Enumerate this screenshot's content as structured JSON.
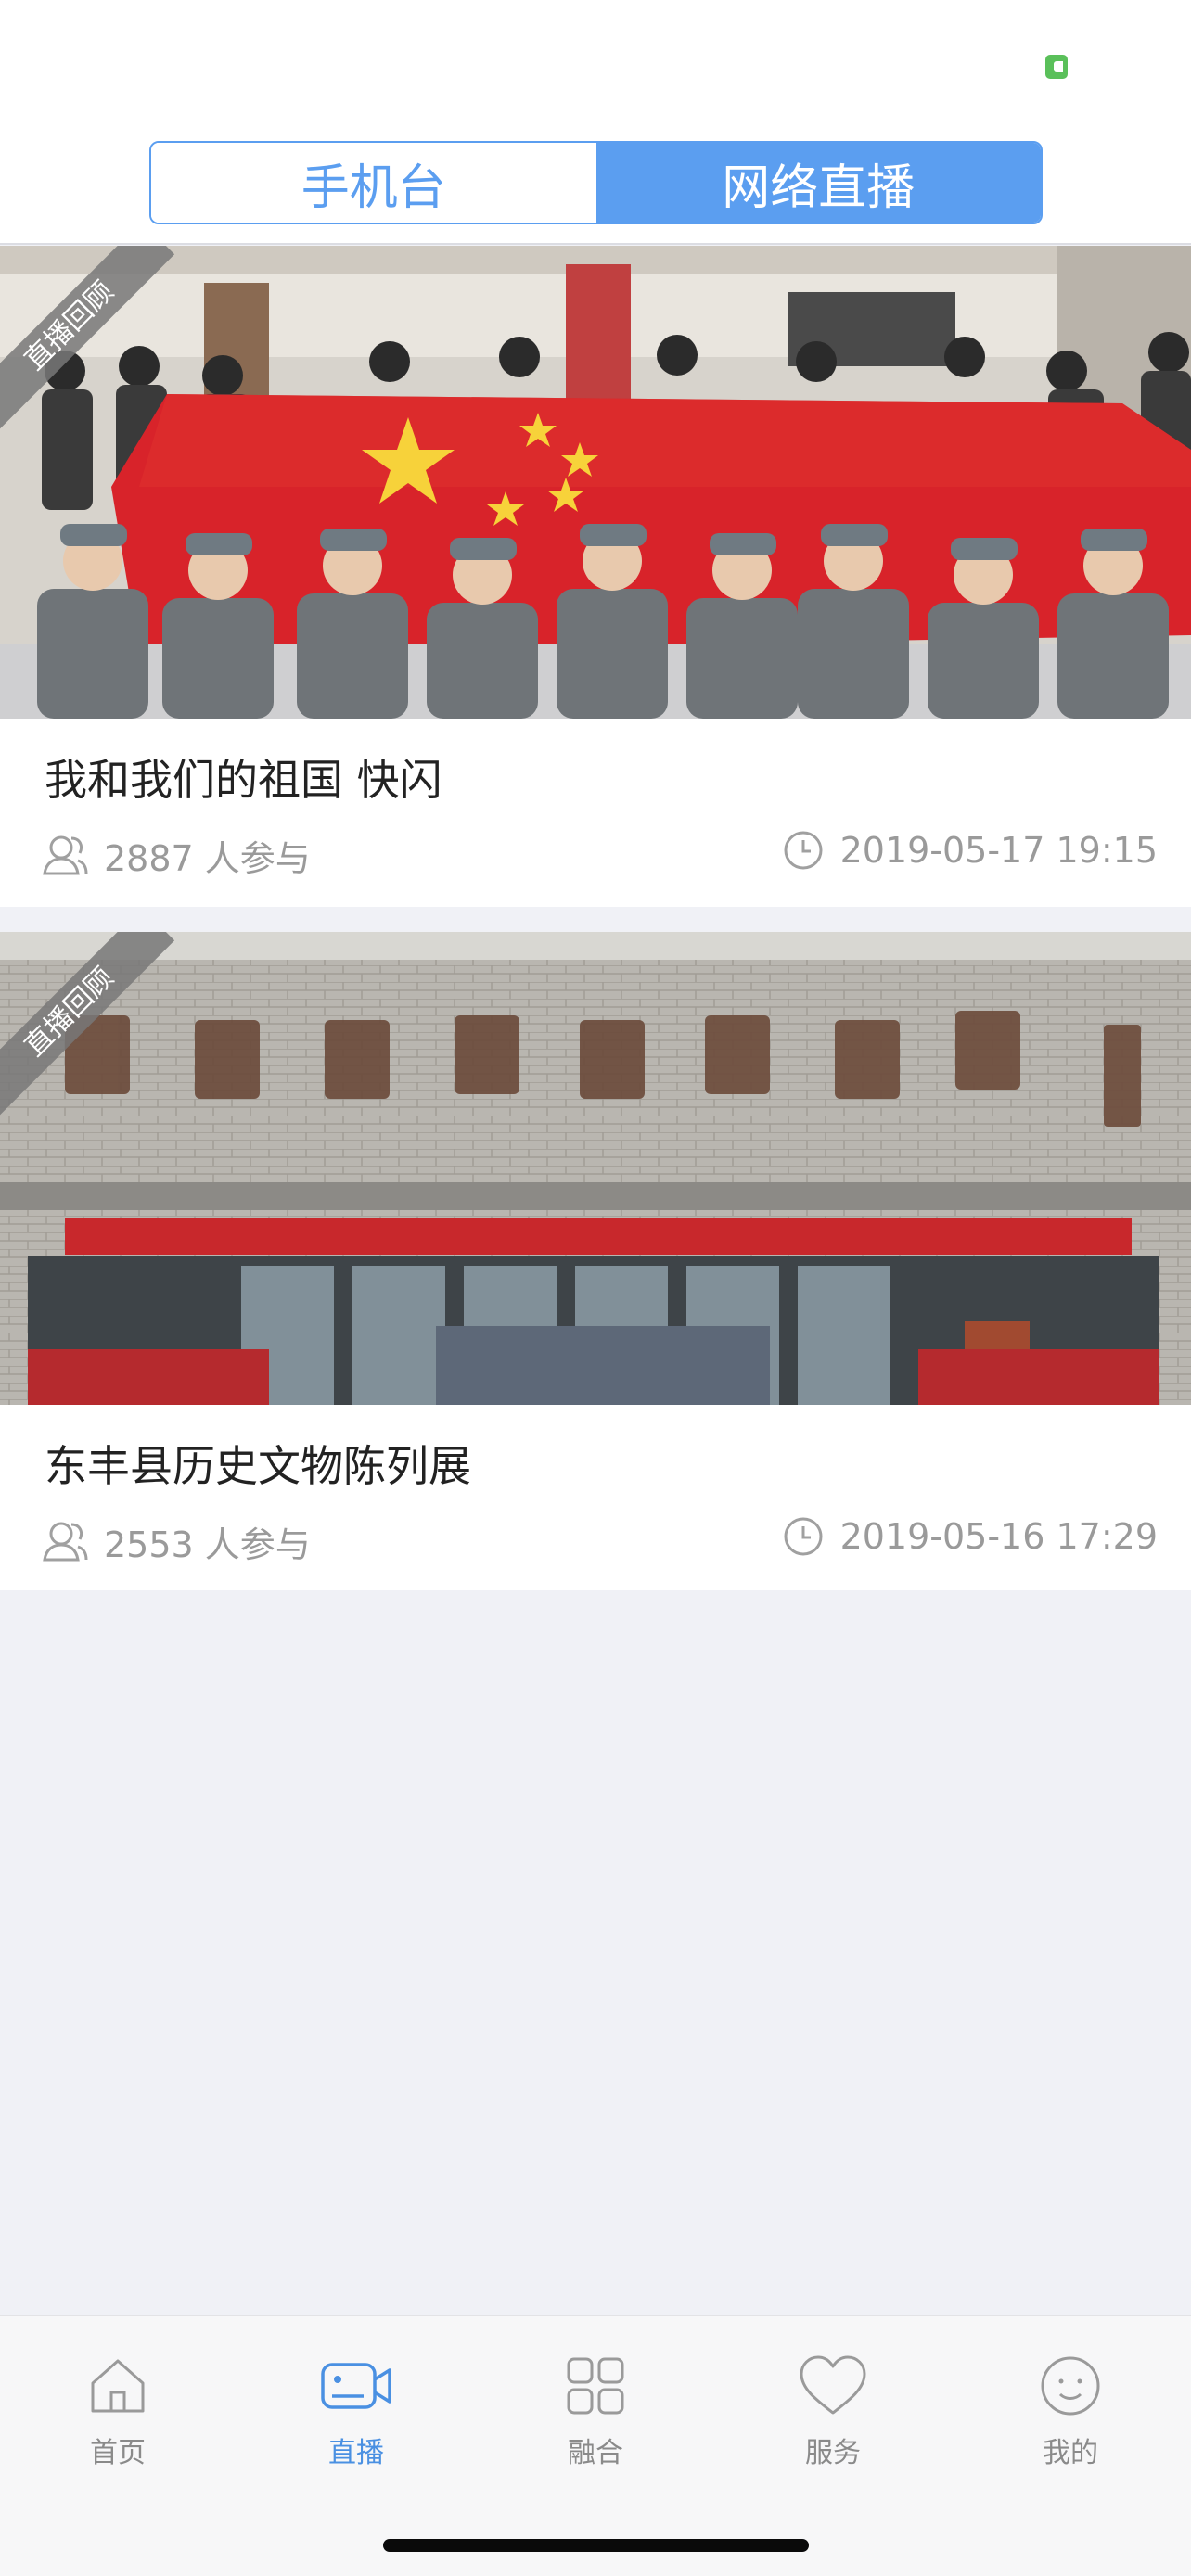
{
  "status_bar": {
    "battery_icon": "battery-charging-icon"
  },
  "segmented": {
    "tabs": [
      {
        "label": "手机台"
      },
      {
        "label": "网络直播"
      }
    ],
    "selected_index": 1
  },
  "cards": [
    {
      "badge": "直播回顾",
      "title": "我和我们的祖国 快闪",
      "participants": "2887 人参与",
      "datetime": "2019-05-17 19:15"
    },
    {
      "badge": "直播回顾",
      "title": "东丰县历史文物陈列展",
      "participants": "2553 人参与",
      "datetime": "2019-05-16 17:29"
    }
  ],
  "tabbar": {
    "items": [
      {
        "label": "首页",
        "icon": "home-icon"
      },
      {
        "label": "直播",
        "icon": "video-camera-icon"
      },
      {
        "label": "融合",
        "icon": "grid-icon"
      },
      {
        "label": "服务",
        "icon": "heart-icon"
      },
      {
        "label": "我的",
        "icon": "smiley-icon"
      }
    ],
    "selected_index": 1
  },
  "colors": {
    "accent": "#5b9ef0",
    "tab_selected": "#4a90e2",
    "muted": "#9a9a9a",
    "background": "#f0f1f6"
  }
}
